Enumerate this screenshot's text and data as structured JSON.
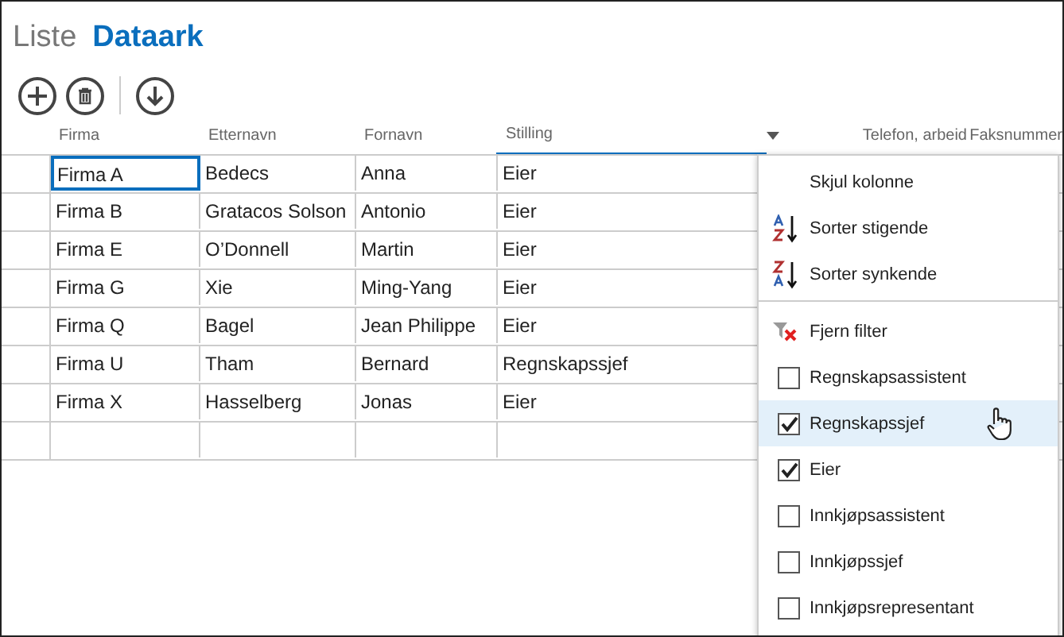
{
  "views": [
    {
      "label": "Liste",
      "selected": false
    },
    {
      "label": "Dataark",
      "selected": true
    }
  ],
  "toolbar": [
    {
      "kind": "add"
    },
    {
      "kind": "delete"
    },
    {
      "kind": "separator"
    },
    {
      "kind": "download"
    }
  ],
  "table": {
    "columns": [
      {
        "label": "Firma",
        "filtered": false
      },
      {
        "label": "Etternavn",
        "filtered": false
      },
      {
        "label": "Fornavn",
        "filtered": false
      },
      {
        "label": "Stilling",
        "filtered": true
      },
      {
        "label": "Telefon, arbeid",
        "filtered": false
      },
      {
        "label": "Faksnummer",
        "filtered": false
      }
    ],
    "rows": [
      {
        "cells": [
          "Firma A",
          "Bedecs",
          "Anna",
          "Eier"
        ],
        "first_cell_selected": true
      },
      {
        "cells": [
          "Firma B",
          "Gratacos Solson",
          "Antonio",
          "Eier"
        ]
      },
      {
        "cells": [
          "Firma E",
          "O’Donnell",
          "Martin",
          "Eier"
        ]
      },
      {
        "cells": [
          "Firma G",
          "Xie",
          "Ming-Yang",
          "Eier"
        ]
      },
      {
        "cells": [
          "Firma Q",
          "Bagel",
          "Jean Philippe",
          "Eier"
        ]
      },
      {
        "cells": [
          "Firma U",
          "Tham",
          "Bernard",
          "Regnskapssjef"
        ]
      },
      {
        "cells": [
          "Firma X",
          "Hasselberg",
          "Jonas",
          "Eier"
        ]
      },
      {
        "cells": [
          "",
          "",
          "",
          ""
        ]
      }
    ]
  },
  "filter_menu": {
    "items": [
      {
        "kind": "hide",
        "label": "Skjul kolonne"
      },
      {
        "kind": "sort_asc",
        "label": "Sorter stigende"
      },
      {
        "kind": "sort_desc",
        "label": "Sorter synkende"
      },
      {
        "kind": "divider"
      },
      {
        "kind": "clear_filter",
        "label": "Fjern filter"
      },
      {
        "kind": "checkbox",
        "label": "Regnskapsassistent",
        "checked": false,
        "hovered": false
      },
      {
        "kind": "checkbox",
        "label": "Regnskapssjef",
        "checked": true,
        "hovered": true
      },
      {
        "kind": "checkbox",
        "label": "Eier",
        "checked": true,
        "hovered": false
      },
      {
        "kind": "checkbox",
        "label": "Innkjøpsassistent",
        "checked": false,
        "hovered": false
      },
      {
        "kind": "checkbox",
        "label": "Innkjøpssjef",
        "checked": false,
        "hovered": false
      },
      {
        "kind": "checkbox",
        "label": "Innkjøpsrepresentant",
        "checked": false,
        "hovered": false
      }
    ]
  }
}
